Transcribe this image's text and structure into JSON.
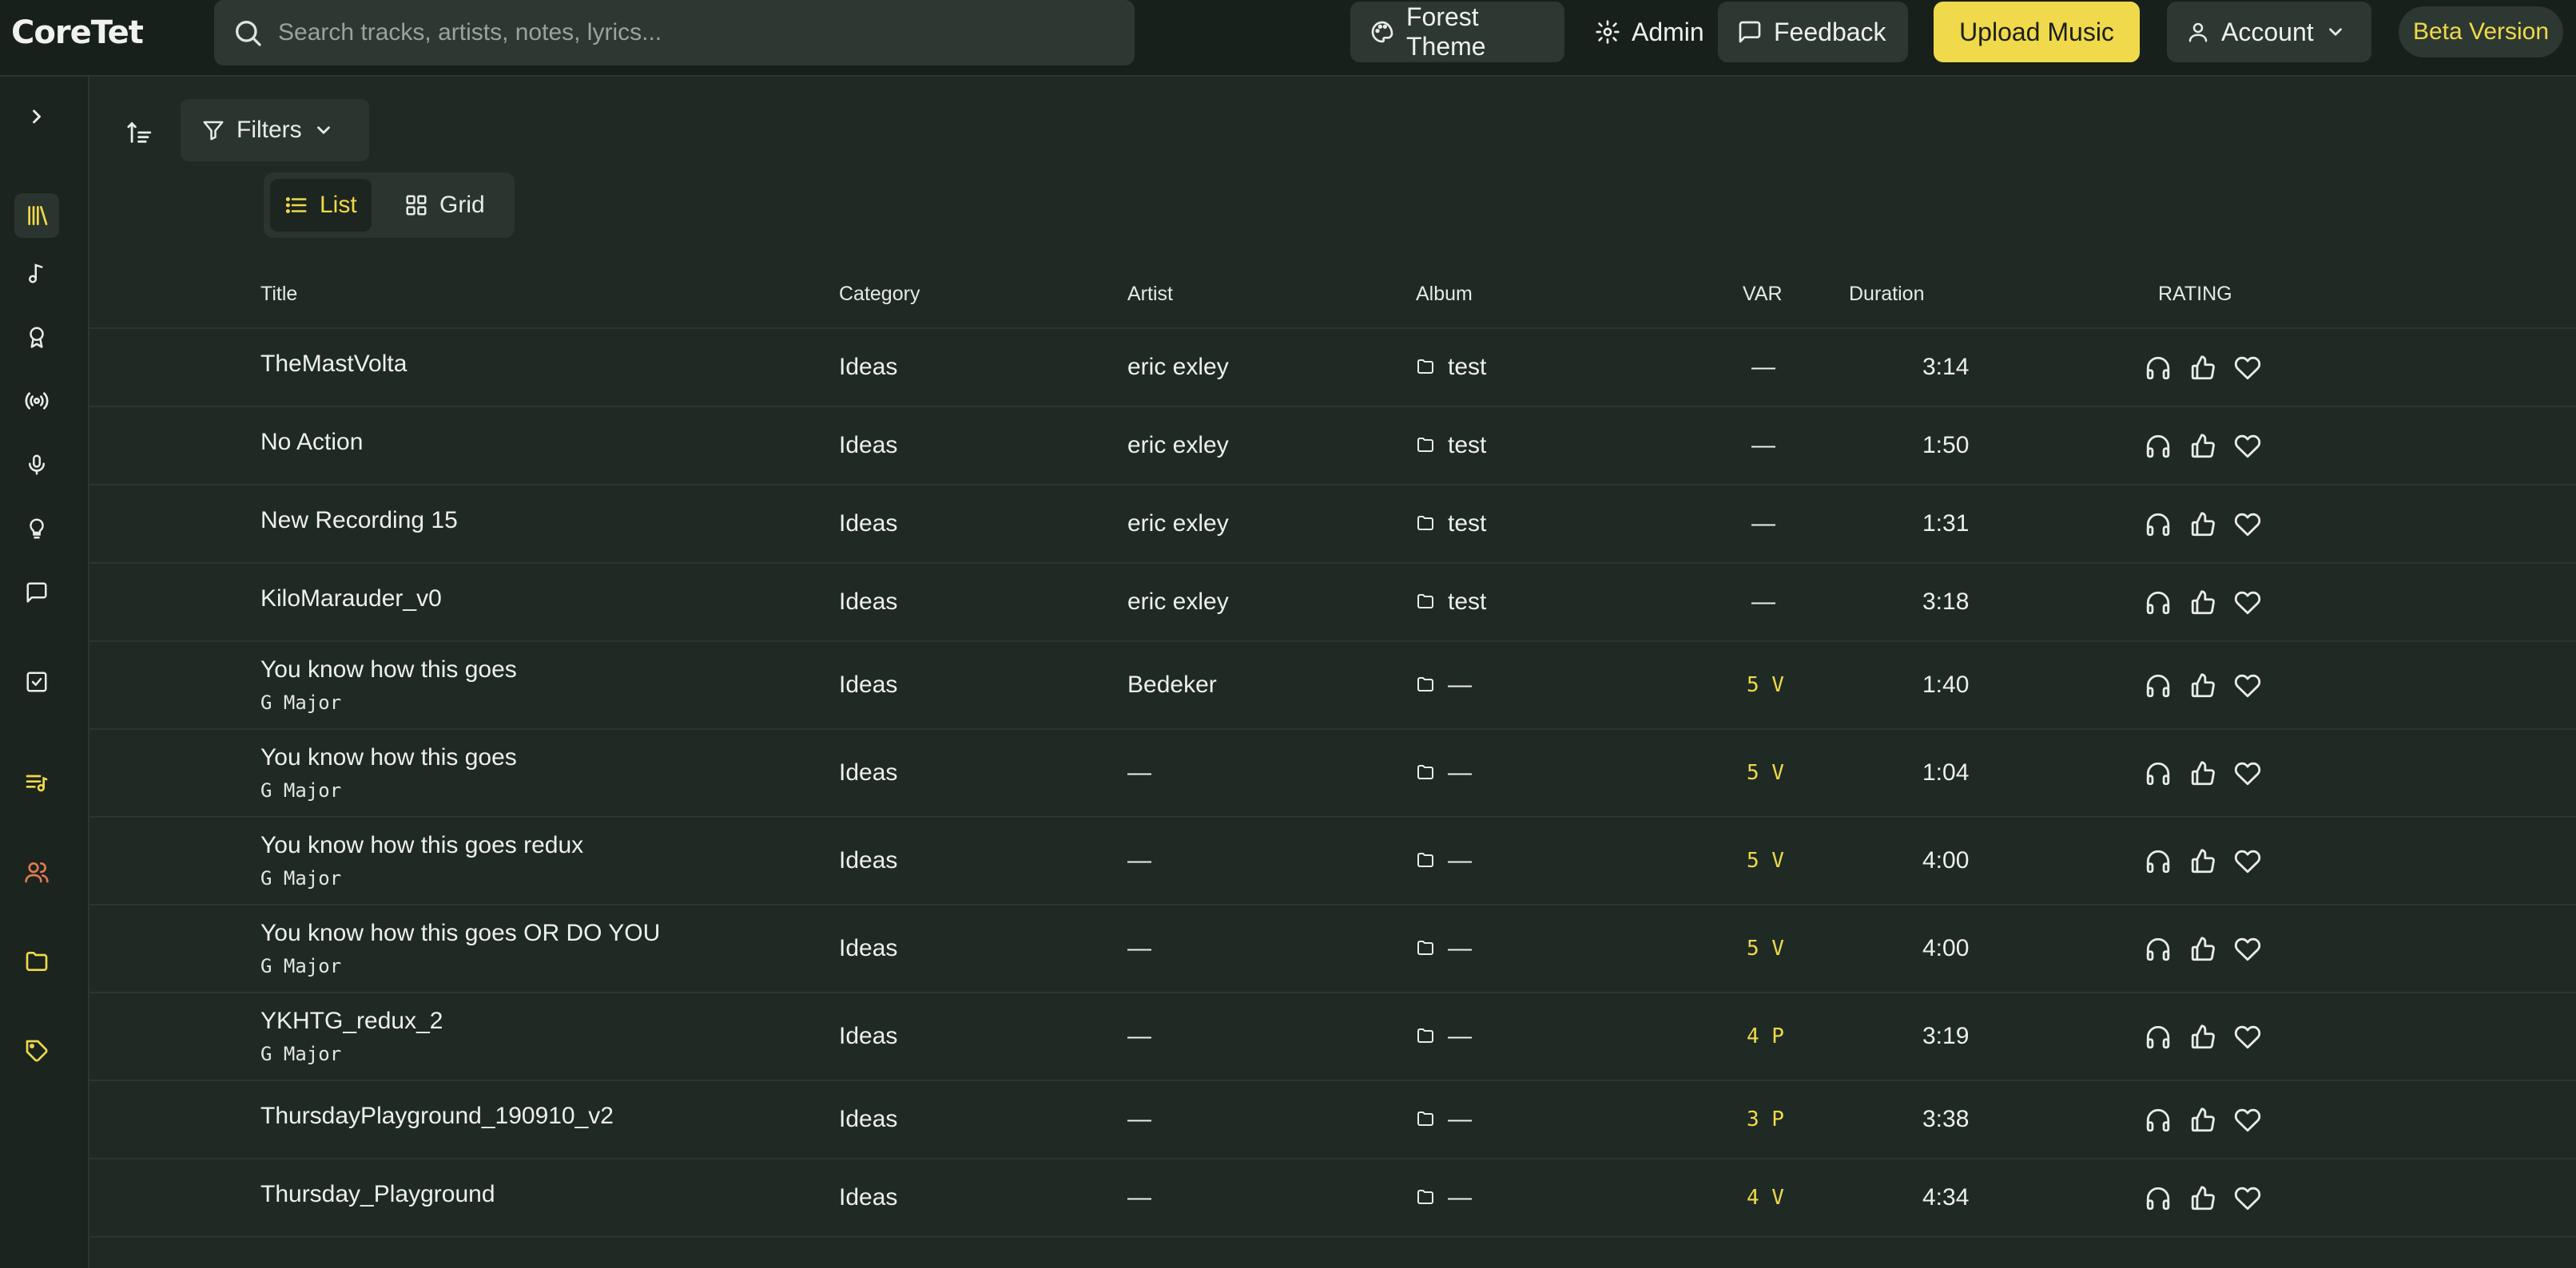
{
  "app": {
    "logo": "CoreTet"
  },
  "search": {
    "placeholder": "Search tracks, artists, notes, lyrics..."
  },
  "header": {
    "theme_label": "Forest Theme",
    "admin_label": "Admin",
    "feedback_label": "Feedback",
    "upload_label": "Upload Music",
    "account_label": "Account",
    "beta_label": "Beta Version"
  },
  "toolbar": {
    "filters_label": "Filters"
  },
  "view": {
    "list_label": "List",
    "grid_label": "Grid",
    "active": "list"
  },
  "columns": {
    "title": "Title",
    "category": "Category",
    "artist": "Artist",
    "album": "Album",
    "var": "VAR",
    "duration": "Duration",
    "rating": "RATING"
  },
  "tracks": [
    {
      "title": "TheMastVolta",
      "key": "",
      "category": "Ideas",
      "artist": "eric exley",
      "album": "test",
      "var": "—",
      "duration": "3:14"
    },
    {
      "title": "No Action",
      "key": "",
      "category": "Ideas",
      "artist": "eric exley",
      "album": "test",
      "var": "—",
      "duration": "1:50"
    },
    {
      "title": "New Recording 15",
      "key": "",
      "category": "Ideas",
      "artist": "eric exley",
      "album": "test",
      "var": "—",
      "duration": "1:31"
    },
    {
      "title": "KiloMarauder_v0",
      "key": "",
      "category": "Ideas",
      "artist": "eric exley",
      "album": "test",
      "var": "—",
      "duration": "3:18"
    },
    {
      "title": "You know how this goes",
      "key": "G Major",
      "category": "Ideas",
      "artist": "Bedeker",
      "album": "—",
      "var": "5 V",
      "duration": "1:40"
    },
    {
      "title": "You know how this goes",
      "key": "G Major",
      "category": "Ideas",
      "artist": "—",
      "album": "—",
      "var": "5 V",
      "duration": "1:04"
    },
    {
      "title": "You know how this goes redux",
      "key": "G Major",
      "category": "Ideas",
      "artist": "—",
      "album": "—",
      "var": "5 V",
      "duration": "4:00"
    },
    {
      "title": "You know how this goes OR DO YOU",
      "key": "G Major",
      "category": "Ideas",
      "artist": "—",
      "album": "—",
      "var": "5 V",
      "duration": "4:00"
    },
    {
      "title": "YKHTG_redux_2",
      "key": "G Major",
      "category": "Ideas",
      "artist": "—",
      "album": "—",
      "var": "4 P",
      "duration": "3:19"
    },
    {
      "title": "ThursdayPlayground_190910_v2",
      "key": "",
      "category": "Ideas",
      "artist": "—",
      "album": "—",
      "var": "3 P",
      "duration": "3:38"
    },
    {
      "title": "Thursday_Playground",
      "key": "",
      "category": "Ideas",
      "artist": "—",
      "album": "—",
      "var": "4 V",
      "duration": "4:34"
    }
  ],
  "colors": {
    "background": "#1f2a24",
    "topbar": "#18201b",
    "accent_yellow": "#f0d94a",
    "accent_orange": "#e07a4f"
  },
  "icons": {
    "sidebar": [
      "chevron-right-icon",
      "library-icon",
      "music-note-icon",
      "award-icon",
      "radio-icon",
      "microphone-icon",
      "lightbulb-icon",
      "message-icon",
      "checkbox-icon",
      "playlist-icon",
      "users-icon",
      "folder-icon",
      "tag-icon"
    ],
    "rating": [
      "headphones-icon",
      "thumbs-up-icon",
      "heart-icon"
    ]
  }
}
